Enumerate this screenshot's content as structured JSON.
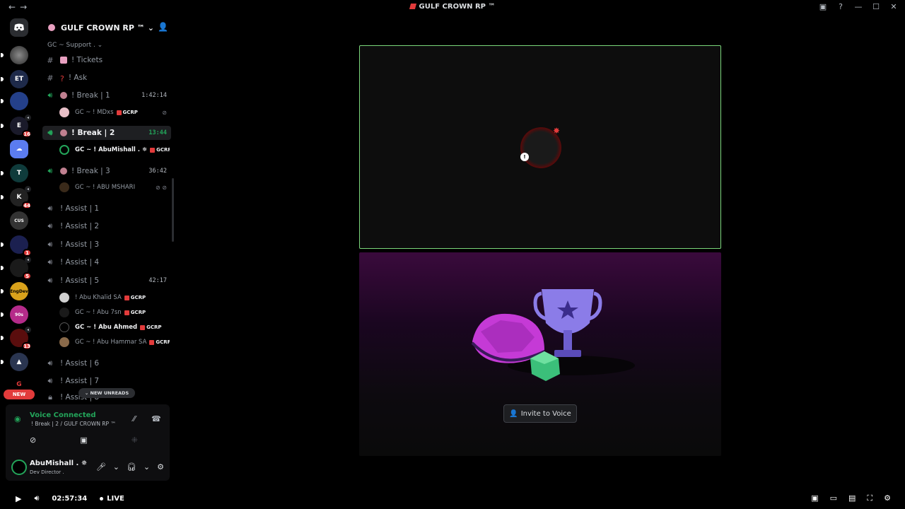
{
  "titlebar": {
    "nav_back": "←",
    "nav_forward": "→",
    "title": "GULF CROWN RP ™",
    "screen_icon": "▣",
    "help_icon": "?",
    "minimize": "—",
    "maximize": "☐",
    "close": "✕"
  },
  "servers": {
    "badges": [
      "16",
      "44",
      "1",
      "5",
      "13"
    ],
    "new_label": "NEW"
  },
  "guild": {
    "name": "GULF CROWN RP ™",
    "chevron": "⌄",
    "category": "GC ~ Support . ⌄"
  },
  "channels": [
    {
      "name": "! Tickets",
      "type": "text"
    },
    {
      "name": "! Ask",
      "type": "text"
    },
    {
      "name": "! Break | 1",
      "type": "voice",
      "timer": "1:42:14"
    },
    {
      "name": "! Break | 2",
      "type": "voice",
      "timer": "13:44"
    },
    {
      "name": "! Break | 3",
      "type": "voice",
      "timer": "36:42"
    },
    {
      "name": "! Assist | 1",
      "type": "voice"
    },
    {
      "name": "! Assist | 2",
      "type": "voice"
    },
    {
      "name": "! Assist | 3",
      "type": "voice"
    },
    {
      "name": "! Assist | 4",
      "type": "voice"
    },
    {
      "name": "! Assist | 5",
      "type": "voice",
      "timer": "42:17"
    },
    {
      "name": "! Assist | 6",
      "type": "voice"
    },
    {
      "name": "! Assist | 7",
      "type": "voice"
    },
    {
      "name": "! Assist | 8",
      "type": "locked"
    }
  ],
  "users": [
    {
      "name": "GC ~ ! MDxs",
      "tag": "GCRP"
    },
    {
      "name": "GC ~ ! AbuMishall . ✵",
      "tag": "GCRP"
    },
    {
      "name": "GC ~ ! ABU MSHARI",
      "tag": ""
    },
    {
      "name": "! Abu Khalid SA",
      "tag": "GCRP"
    },
    {
      "name": "GC ~ ! Abu 7sn",
      "tag": "GCRP"
    },
    {
      "name": "GC ~ ! Abu Ahmed",
      "tag": "GCRP"
    },
    {
      "name": "GC ~ ! Abu Hammar SA",
      "tag": "GCRP"
    }
  ],
  "new_unreads": "⌄ NEW UNREADS",
  "voice": {
    "status": "Voice Connected",
    "location": "! Break | 2 / GULF CROWN RP ™"
  },
  "me": {
    "name": "AbuMishall . ✵",
    "status": "Dev Director ."
  },
  "stage": {
    "invite_label": "Invite to Voice"
  },
  "player": {
    "time": "02:57:34",
    "live": "LIVE"
  },
  "colors": {
    "accent_green": "#23a55a",
    "danger_red": "#e23b3b",
    "stage_border": "#7ad67a"
  }
}
